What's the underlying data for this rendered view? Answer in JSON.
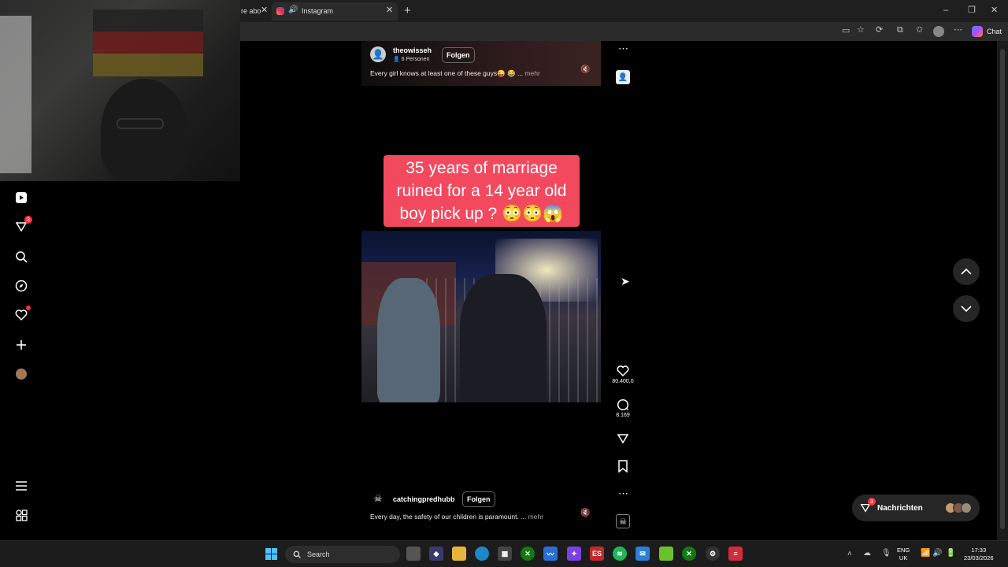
{
  "browser": {
    "tabs": [
      {
        "label": "re abo"
      },
      {
        "label": "Instagram"
      }
    ],
    "new_tab": "+",
    "toolbar_chat": "Chat",
    "window_controls": {
      "minimize": "–",
      "maximize": "❐",
      "close": "✕"
    }
  },
  "sidebar": {
    "notifications_badge": "3"
  },
  "reels": [
    {
      "author": "theowisseh",
      "viewers": "6 Personen",
      "follow_label": "Folgen",
      "description": "Every girl knows at least one of these guys😜 😂 ...",
      "more_label": "mehr"
    },
    {
      "author": "catchingpredhubb",
      "follow_label": "Folgen",
      "overlay_text": "35 years of marriage ruined for a 14 year old boy pick up ? 😳😳😱",
      "description": "Every day, the safety of our children is paramount. ...",
      "more_label": "mehr",
      "likes": "80.400,0",
      "comments": "8.169"
    }
  ],
  "messages": {
    "label": "Nachrichten",
    "badge": "3"
  },
  "taskbar": {
    "search_placeholder": "Search",
    "lang_top": "ENG",
    "lang_bottom": "UK",
    "time": "17:33",
    "date": "23/03/2026"
  },
  "colors": {
    "accent_red": "#ff3040",
    "caption_pink": "#f2495f"
  }
}
